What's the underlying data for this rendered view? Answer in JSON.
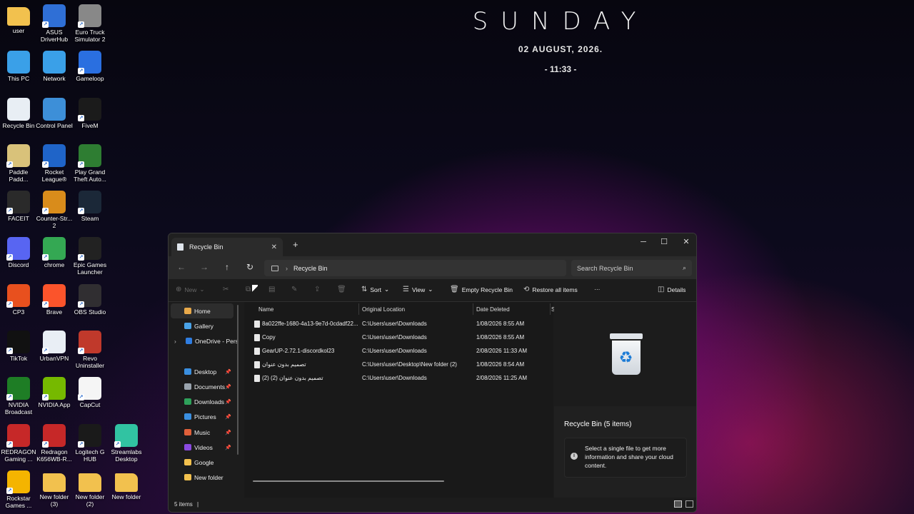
{
  "clock": {
    "day": "SUNDAY",
    "date": "02 AUGUST, 2026.",
    "time": "- 11:33 -"
  },
  "desktop_icons": [
    {
      "label": "user",
      "icon": "folder-icon",
      "color": "#f2c14e"
    },
    {
      "label": "ASUS DriverHub",
      "icon": "gear-icon",
      "color": "#2f6fd6"
    },
    {
      "label": "Euro Truck Simulator 2",
      "icon": "truck-icon",
      "color": "#888888"
    },
    {
      "label": "This PC",
      "icon": "monitor-icon",
      "color": "#3aa0e8"
    },
    {
      "label": "Network",
      "icon": "network-icon",
      "color": "#3aa0e8"
    },
    {
      "label": "Gameloop",
      "icon": "gameloop-icon",
      "color": "#2a6fe0"
    },
    {
      "label": "Recycle Bin",
      "icon": "recycle-bin-icon",
      "color": "#e8eef4"
    },
    {
      "label": "Control Panel",
      "icon": "control-panel-icon",
      "color": "#3d8fd8"
    },
    {
      "label": "FiveM",
      "icon": "fivem-icon",
      "color": "#1b1b1b"
    },
    {
      "label": "Paddle Padd...",
      "icon": "paddle-icon",
      "color": "#d9c27a"
    },
    {
      "label": "Rocket League®",
      "icon": "rocket-league-icon",
      "color": "#1f64c8"
    },
    {
      "label": "Play Grand Theft Auto...",
      "icon": "gta-icon",
      "color": "#2e7d32"
    },
    {
      "label": "FACEIT",
      "icon": "faceit-icon",
      "color": "#2a2a2a"
    },
    {
      "label": "Counter-Str... 2",
      "icon": "cs2-icon",
      "color": "#d98c1b"
    },
    {
      "label": "Steam",
      "icon": "steam-icon",
      "color": "#1b2838"
    },
    {
      "label": "Discord",
      "icon": "discord-icon",
      "color": "#5865f2"
    },
    {
      "label": "chrome",
      "icon": "chrome-icon",
      "color": "#34a853"
    },
    {
      "label": "Epic Games Launcher",
      "icon": "epic-icon",
      "color": "#222222"
    },
    {
      "label": "CP3",
      "icon": "cp3-icon",
      "color": "#e8501e"
    },
    {
      "label": "Brave",
      "icon": "brave-icon",
      "color": "#fb542b"
    },
    {
      "label": "OBS Studio",
      "icon": "obs-icon",
      "color": "#302e31"
    },
    {
      "label": "TikTok",
      "icon": "tiktok-icon",
      "color": "#111111"
    },
    {
      "label": "UrbanVPN",
      "icon": "vpn-icon",
      "color": "#e9eef5"
    },
    {
      "label": "Revo Uninstaller",
      "icon": "revo-icon",
      "color": "#c0392b"
    },
    {
      "label": "NVIDIA Broadcast",
      "icon": "nvidia-broadcast-icon",
      "color": "#1e7d25"
    },
    {
      "label": "NVIDIA App",
      "icon": "nvidia-icon",
      "color": "#76b900"
    },
    {
      "label": "CapCut",
      "icon": "capcut-icon",
      "color": "#f5f5f5"
    },
    {
      "label": "REDRAGON Gaming ...",
      "icon": "redragon-icon",
      "color": "#c62828"
    },
    {
      "label": "Redragon K656WB-R...",
      "icon": "redragon-icon",
      "color": "#c62828"
    },
    {
      "label": "Logitech G HUB",
      "icon": "logitech-icon",
      "color": "#1a1a1a"
    },
    {
      "label": "Streamlabs Desktop",
      "icon": "streamlabs-icon",
      "color": "#31c3a2"
    },
    {
      "label": "Rockstar Games ...",
      "icon": "rockstar-icon",
      "color": "#f4b400"
    },
    {
      "label": "New folder (3)",
      "icon": "folder-icon",
      "color": "#f2c14e"
    },
    {
      "label": "New folder (2)",
      "icon": "folder-icon",
      "color": "#f2c14e"
    },
    {
      "label": "New folder",
      "icon": "folder-icon",
      "color": "#f2c14e"
    }
  ],
  "window": {
    "tab_title": "Recycle Bin",
    "new_tab": "+",
    "controls": {
      "minimize": "─",
      "maximize": "☐",
      "close": "✕"
    },
    "address": {
      "path": "Recycle Bin"
    },
    "search": {
      "placeholder": "Search Recycle Bin"
    },
    "toolbar": {
      "new": "New",
      "sort": "Sort",
      "view": "View",
      "empty": "Empty Recycle Bin",
      "restore": "Restore all items",
      "more": "···",
      "details": "Details"
    },
    "nav": [
      {
        "label": "Home",
        "color": "#e8a94a",
        "selected": true
      },
      {
        "label": "Gallery",
        "color": "#4aa3e8"
      },
      {
        "label": "OneDrive - Perso",
        "color": "#2f7de1"
      },
      {
        "label": "Desktop",
        "color": "#3a8fe0",
        "pinned": true
      },
      {
        "label": "Documents",
        "color": "#9aa4ae",
        "pinned": true
      },
      {
        "label": "Downloads",
        "color": "#2ea15a",
        "pinned": true
      },
      {
        "label": "Pictures",
        "color": "#3a8fe0",
        "pinned": true
      },
      {
        "label": "Music",
        "color": "#e0603a",
        "pinned": true
      },
      {
        "label": "Videos",
        "color": "#8a4ae0",
        "pinned": true
      },
      {
        "label": "Google",
        "color": "#f2c14e"
      },
      {
        "label": "New folder",
        "color": "#f2c14e"
      }
    ],
    "columns": {
      "name": "Name",
      "location": "Original Location",
      "date": "Date Deleted",
      "extra": "S"
    },
    "files": [
      {
        "name": "8a022ffe-1680-4a13-9e7d-0cdadf22...",
        "location": "C:\\Users\\user\\Downloads",
        "date": "1/08/2026 8:55 AM"
      },
      {
        "name": "Copy",
        "location": "C:\\Users\\user\\Downloads",
        "date": "1/08/2026 8:55 AM"
      },
      {
        "name": "GearUP-2.72.1-discordkol23",
        "location": "C:\\Users\\user\\Downloads",
        "date": "2/08/2026 11:33 AM"
      },
      {
        "name": "تصميم بدون عنوان",
        "location": "C:\\Users\\user\\Desktop\\New folder (2)",
        "date": "1/08/2026 8:54 AM"
      },
      {
        "name": "(تصميم بدون عنوان (2) (2",
        "location": "C:\\Users\\user\\Downloads",
        "date": "2/08/2026 11:25 AM"
      }
    ],
    "details": {
      "title": "Recycle Bin (5 items)",
      "info": "Select a single file to get more information and share your cloud content."
    },
    "status": {
      "count": "5 items",
      "separator": "|"
    }
  }
}
